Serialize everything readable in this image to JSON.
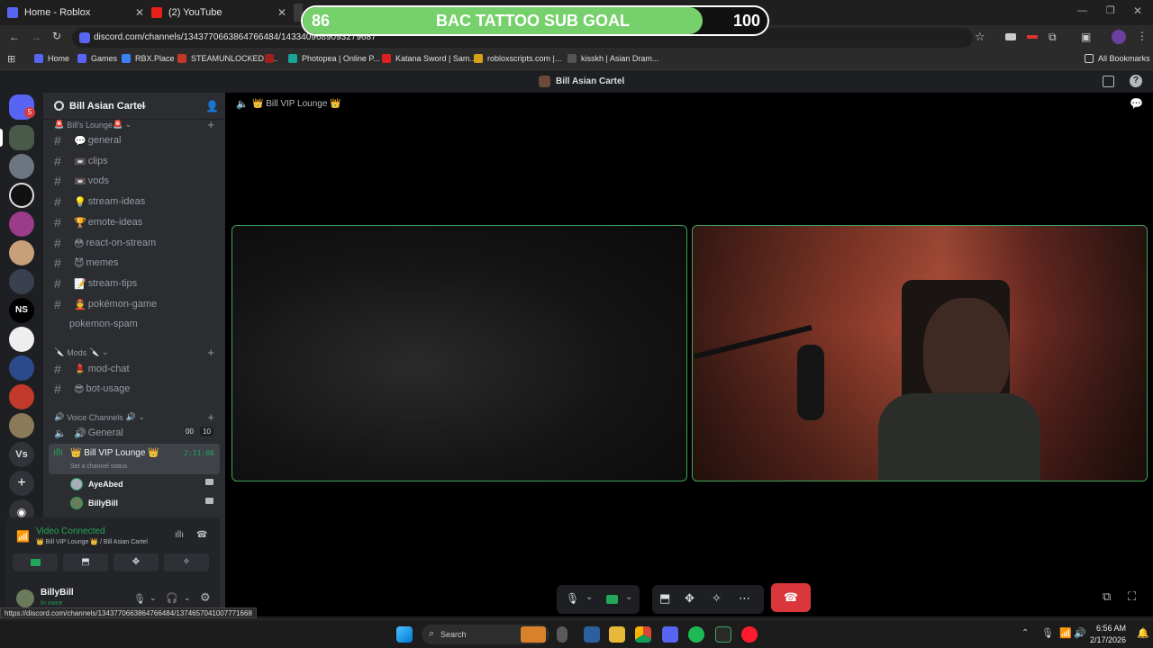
{
  "browser": {
    "tabs": [
      {
        "title": "Home - Roblox"
      },
      {
        "title": "(2) YouTube"
      }
    ],
    "url": "discord.com/channels/1343770663864766484/1433409689093279687",
    "bookmarks": [
      "Home",
      "Games",
      "RBX.Place",
      "STEAMUNLOCKED »...",
      "Photopea | Online P...",
      "Katana Sword | Sam...",
      "robloxscripts.com |...",
      "kisskh | Asian Dram..."
    ],
    "all_bookmarks": "All Bookmarks",
    "status_url": "https://discord.com/channels/1343770663864766484/1374657041007771668"
  },
  "overlay": {
    "current": "86",
    "label": "BAC TATTOO SUB GOAL",
    "target": "100",
    "progress": 0.86
  },
  "discord": {
    "window_title": "Bill Asian Cartel",
    "guild_badge": "5",
    "server_name": "Bill Asian Cartel",
    "categories": {
      "lounge": "Bill's Lounge",
      "mods": "Mods",
      "voice": "Voice Channels"
    },
    "channels": [
      {
        "emoji": "💬",
        "name": "general"
      },
      {
        "emoji": "📼",
        "name": "clips"
      },
      {
        "emoji": "📼",
        "name": "vods"
      },
      {
        "emoji": "💡",
        "name": "stream-ideas"
      },
      {
        "emoji": "🏆",
        "name": "emote-ideas"
      },
      {
        "emoji": "😳",
        "name": "react-on-stream"
      },
      {
        "emoji": "😈",
        "name": "memes"
      },
      {
        "emoji": "📝",
        "name": "stream-tips"
      },
      {
        "emoji": "👲",
        "name": "pokémon-game"
      },
      {
        "emoji": "",
        "name": "pokemon-spam"
      }
    ],
    "mod_channels": [
      {
        "emoji": "💄",
        "name": "mod-chat"
      },
      {
        "emoji": "😎",
        "name": "bot-usage"
      }
    ],
    "voice_general": {
      "name": "General",
      "count_a": "00",
      "count_b": "10"
    },
    "vip_lounge": {
      "name": "👑 Bill VIP Lounge 👑",
      "timer": "2:11:08",
      "status": "Set a channel status"
    },
    "voice_members": [
      "AyeAbed",
      "BillyBill"
    ],
    "voice_panel": {
      "status": "Video Connected",
      "location": "👑 Bill VIP Lounge 👑 / Bill Asian Cartel"
    },
    "user": {
      "name": "BillyBill",
      "status": "In voice"
    },
    "channel_header": "👑 Bill VIP Lounge 👑",
    "server_icons": [
      "NS",
      "Vs"
    ]
  },
  "taskbar": {
    "search": "Search",
    "time": "6:56 AM",
    "date": "2/17/2026"
  },
  "colors": {
    "accent": "#3ba55d",
    "overlay": "#76d06b",
    "hangup": "#da373c"
  }
}
